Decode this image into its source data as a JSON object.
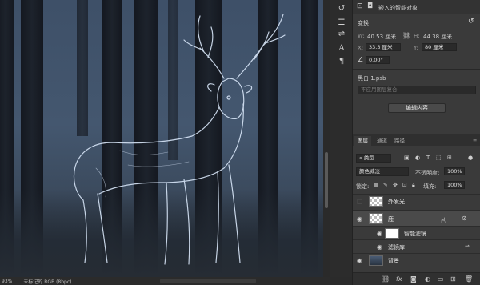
{
  "status": {
    "zoom": "93%",
    "color_mode": "未标记的 RGB (8bpc)"
  },
  "properties": {
    "header": "嵌入的智能对象",
    "section_transform": "变换",
    "w_label": "W:",
    "w_value": "40.53 厘米",
    "h_label": "H:",
    "h_value": "44.38 厘米",
    "x_label": "X:",
    "x_value": "33.3 厘米",
    "y_label": "Y:",
    "y_value": "80 厘米",
    "angle_value": "0.00°",
    "file_name": "黑白 1.psb",
    "composite_placeholder": "不应用图层复合",
    "edit_button": "编辑内容"
  },
  "layers_panel": {
    "tabs": [
      "图层",
      "通道",
      "路径"
    ],
    "filter_kind": "类型",
    "blend_mode": "颜色减淡",
    "opacity_label": "不透明度:",
    "opacity_value": "100%",
    "lock_label": "锁定:",
    "fill_label": "填充:",
    "fill_value": "100%",
    "layers": [
      {
        "name": "外发光"
      },
      {
        "name": "鹿"
      },
      {
        "name": "智能滤镜"
      },
      {
        "name": "滤镜库"
      },
      {
        "name": "背景"
      }
    ],
    "bottom_icons": [
      "link-icon",
      "fx-icon",
      "mask-icon",
      "adjustment-icon",
      "group-icon",
      "new-layer-icon",
      "trash-icon"
    ]
  },
  "colors": {
    "panel_bg": "#3a3a3a",
    "canvas_sky": "#44576f",
    "selected_row": "#4a4a4a"
  }
}
